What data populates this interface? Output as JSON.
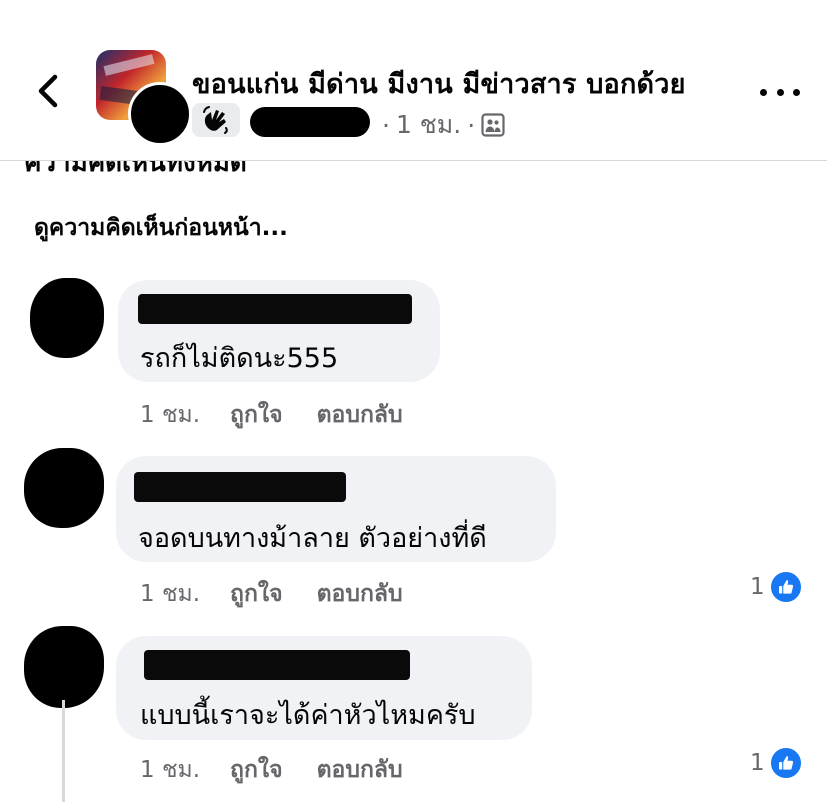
{
  "header": {
    "group_name": "ขอนแก่น มีด่าน มีงาน มีข่าวสาร บอกด้วย",
    "time": "1 ชม.",
    "separator": "·"
  },
  "section": {
    "cutoff_title": "ความคิดเห็นทั้งหมด",
    "view_previous": "ดูความคิดเห็นก่อนหน้า..."
  },
  "actions": {
    "like": "ถูกใจ",
    "reply": "ตอบกลับ"
  },
  "comments": [
    {
      "text": "รถก็ไม่ติดนะ555",
      "time": "1 ชม.",
      "like_count": ""
    },
    {
      "text": "จอดบนทางม้าลาย ตัวอย่างที่ดี",
      "time": "1 ชม.",
      "like_count": "1"
    },
    {
      "text": "แบบนี้เราจะได้ค่าหัวไหมครับ",
      "time": "1 ชม.",
      "like_count": "1"
    }
  ],
  "colors": {
    "background": "#ffffff",
    "bubble": "#f0f2f5",
    "secondary_text": "#65676b",
    "like_blue": "#1877f2"
  },
  "icons": {
    "back": "chevron-left-icon",
    "badge": "waving-hand-icon",
    "audience": "group-audience-icon",
    "more": "more-horizontal-icon",
    "like": "thumbs-up-icon"
  }
}
